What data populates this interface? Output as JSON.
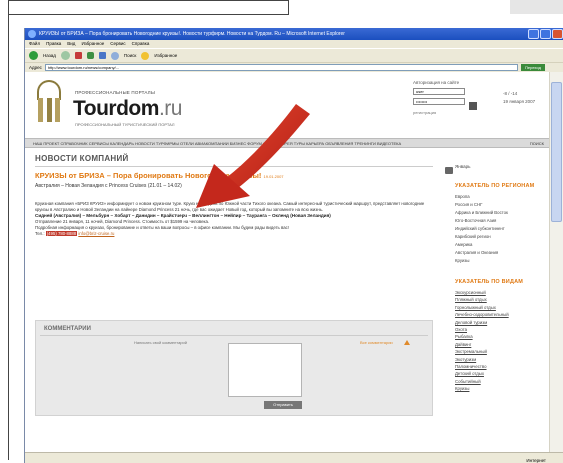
{
  "window": {
    "title": "КРУИЗЫ от БРИЗА – Пора бронировать Новогодние круизы!. Новости турфирм. Новости на Турдом. Ru – Microsoft Internet Explorer",
    "menu": [
      "Файл",
      "Правка",
      "Вид",
      "Избранное",
      "Сервис",
      "Справка"
    ],
    "toolbar": {
      "back_label": "Назад",
      "favorites_label": "Избранное",
      "search_label": "Поиск"
    },
    "address_label": "Адрес",
    "address_value": "http://www.tourdom.ru/news/company/...",
    "go_label": "Переход",
    "status_text": "",
    "status_zone": "Интернет"
  },
  "header": {
    "tagline": "ПРОФЕССИОНАЛЬНЫЕ ПОРТАЛЫ",
    "brand_name": "Tourdom",
    "brand_tld": ".ru",
    "brand_sub": "ПРОФЕССИОНАЛЬНЫЙ ТУРИСТИЧЕСКИЙ ПОРТАЛ",
    "login_title": "Авторизация на сайте",
    "login_user": "user",
    "login_pass": "••••••••",
    "login_link": "регистрация",
    "weather_temp": "-8 / -14",
    "weather_date": "19 января 2007"
  },
  "navbar": {
    "items": "НАШ ПРОЕКТ  СПРАВОЧНИК  СЕРВИСЫ  КАЛЕНДАРЬ  НОВОСТИ  ТУРФИРМЫ  ОТЕЛИ  АВИАКОМПАНИИ  БИЗНЕС  ФОРУМ  ФОТОГАЛЕРЕЯ  ТУРЫ  КАРЬЕРА  ОБЪЯВЛЕНИЯ  ТРЕНИНГИ  ВИДЕОТЕКА",
    "right": "ПОИСК"
  },
  "main": {
    "section_title": "НОВОСТИ КОМПАНИЙ",
    "article_title": "КРУИЗЫ от БРИЗА – Пора бронировать Новогодние круизы!",
    "article_title_small": "19.01.2007",
    "article_sub": "Австралия – Новая Зеландия с Princess Cruises (21.01 – 14.02)",
    "para1": "Круизная компания «БРИЗ КРУИЗ» информирует о новом круизном туре. Круиз на 21 день по Южной части Тихого океана. Самый интересный туристический маршрут, представляет новогодние круизы в Австралию и Новой Зеландии на лайнере Diamond Princess 21 ночь, где вас ожидает Новый год, который вы запомните на всю жизнь.",
    "para2_bold": "Сидней (Австралия) – Мельбурн – Хобарт – Данидин – Крайстчерч – Веллингтон – Нейпир – Тауранга – Окленд (Новая Зеландия)",
    "para2": "Отправление 21 января, 11 ночей, Diamond Princess. Стоимость от $1599 на человека.",
    "para3": "Подробная информация о круизах, бронирование и ответы на ваши вопросы – в офисе компании. Мы будем рады видеть вас!",
    "contact_label": "Тел.:",
    "contact_phone": "(495) 780-8888",
    "contact_email": "info@briz-cruise.ru",
    "comments_title": "КОММЕНТАРИИ",
    "comment_label": "Написать свой комментарий",
    "comment_side": "Все комментарии",
    "comment_submit": "Отправить"
  },
  "sidebar": {
    "date": "Январь",
    "head1": "УКАЗАТЕЛЬ ПО РЕГИОНАМ",
    "regions": [
      "Европа",
      "Россия и СНГ",
      "Африка и Ближний Восток",
      "Юго-Восточная Азия",
      "Индийский субконтинент",
      "Карибский регион",
      "Америка",
      "Австралия и Океания",
      "Круизы"
    ],
    "head2": "УКАЗАТЕЛЬ ПО ВИДАМ",
    "kinds": [
      "Экскурсионный",
      "Пляжный отдых",
      "Горнолыжный отдых",
      "Лечебно-оздоровительный",
      "Деловой туризм",
      "Охота",
      "Рыбалка",
      "Дайвинг",
      "Экстремальный",
      "Экотуризм",
      "Паломничество",
      "Детский отдых",
      "Событийный",
      "Круизы"
    ]
  }
}
